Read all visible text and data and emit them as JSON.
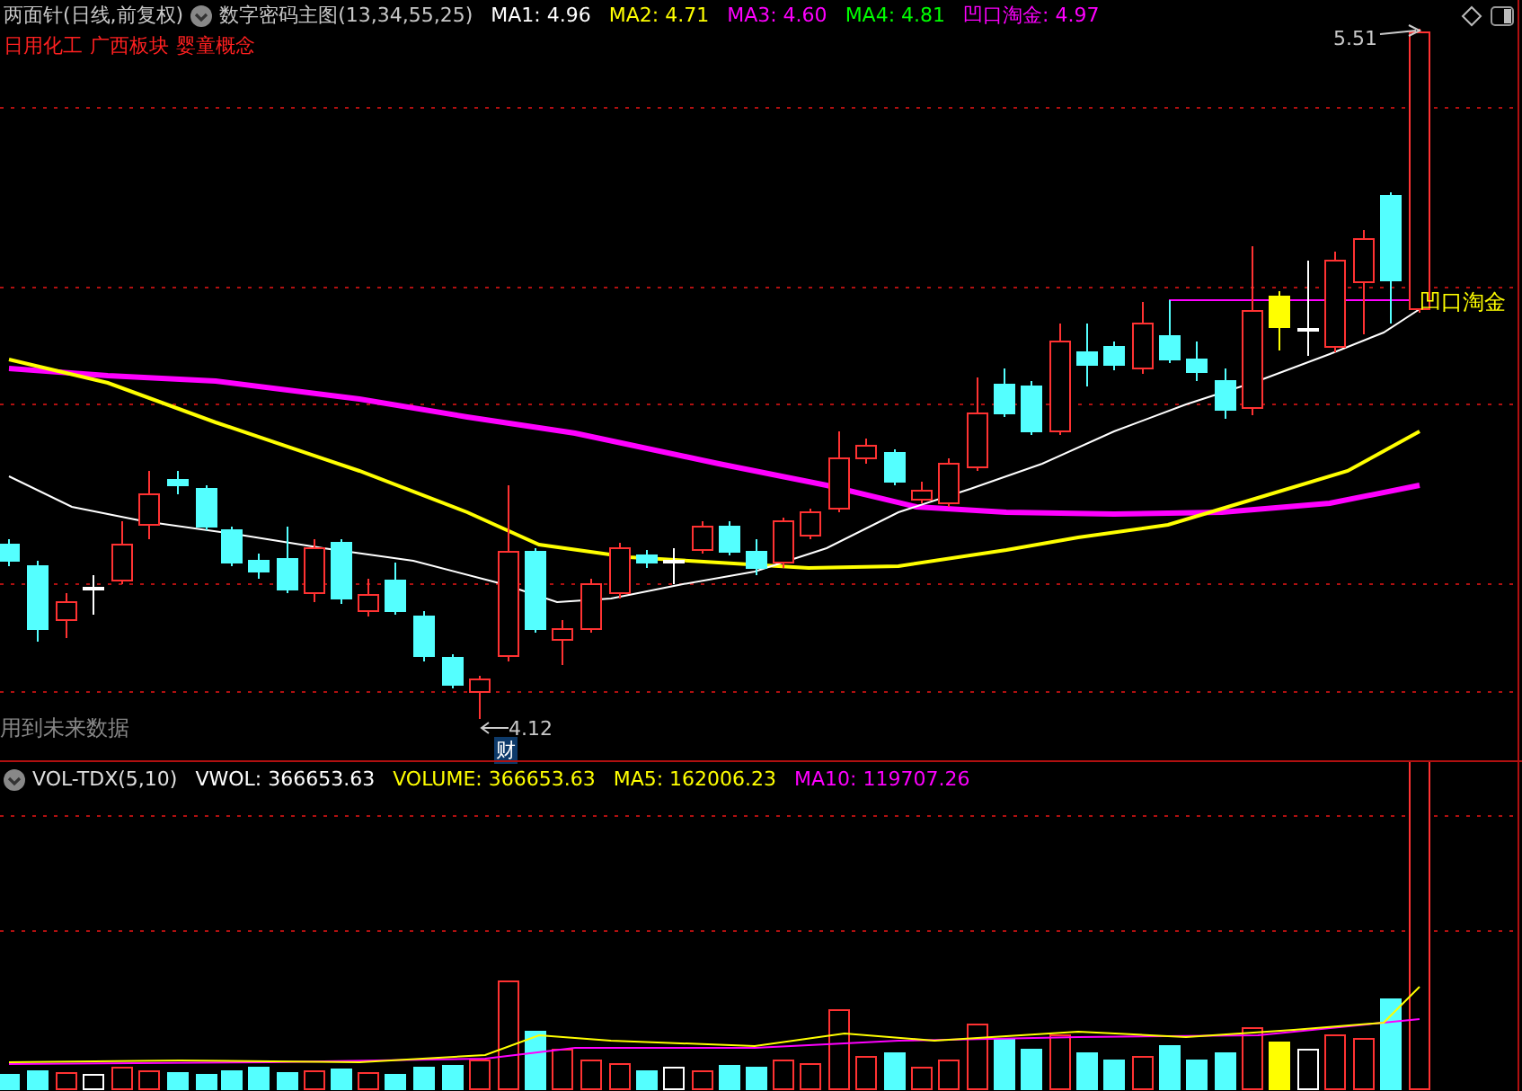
{
  "header": {
    "stock": "两面针(日线,前复权)",
    "indicator": "数字密码主图(13,34,55,25)",
    "readings": [
      {
        "text": "MA1: 4.96",
        "color": "#ffffff"
      },
      {
        "text": "MA2: 4.71",
        "color": "#ffff00"
      },
      {
        "text": "MA3: 4.60",
        "color": "#ff00ff"
      },
      {
        "text": "MA4: 4.81",
        "color": "#00ff00"
      },
      {
        "text": "凹口淘金: 4.97",
        "color": "#ff00ff"
      }
    ]
  },
  "tags": [
    "日用化工",
    "广西板块",
    "婴童概念"
  ],
  "chart": {
    "high_label": "5.51",
    "low_label": "4.12",
    "marker": "财",
    "signal_label": "凹口淘金",
    "notice": "用到未来数据"
  },
  "volume": {
    "indicator": "VOL-TDX(5,10)",
    "readings": [
      {
        "text": "VWOL: 366653.63",
        "color": "#ffffff"
      },
      {
        "text": "VOLUME: 366653.63",
        "color": "#ffff00"
      },
      {
        "text": "MA5: 162006.23",
        "color": "#ffff00"
      },
      {
        "text": "MA10: 119707.26",
        "color": "#ff00ff"
      }
    ]
  }
}
